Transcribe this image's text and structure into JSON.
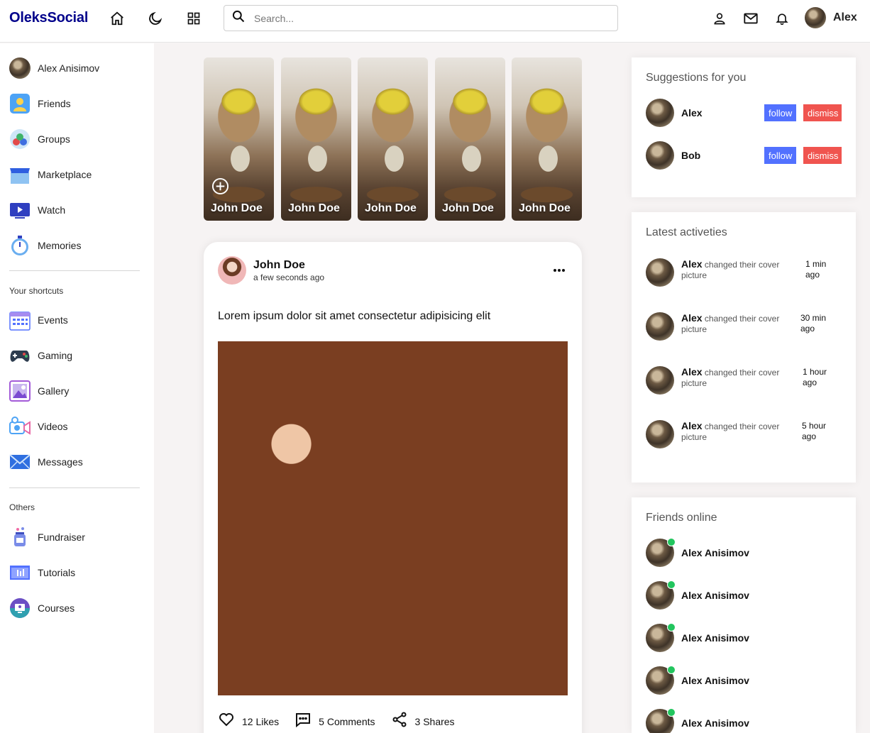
{
  "navbar": {
    "logo": "OleksSocial",
    "search_placeholder": "Search...",
    "user_name": "Alex"
  },
  "left": {
    "profile_name": "Alex Anisimov",
    "main_items": [
      "Friends",
      "Groups",
      "Marketplace",
      "Watch",
      "Memories"
    ],
    "shortcuts_title": "Your shortcuts",
    "shortcut_items": [
      "Events",
      "Gaming",
      "Gallery",
      "Videos",
      "Messages"
    ],
    "others_title": "Others",
    "other_items": [
      "Fundraiser",
      "Tutorials",
      "Courses"
    ]
  },
  "stories": [
    {
      "name": "John Doe"
    },
    {
      "name": "John Doe"
    },
    {
      "name": "John Doe"
    },
    {
      "name": "John Doe"
    },
    {
      "name": "John Doe"
    }
  ],
  "post": {
    "author": "John Doe",
    "time": "a few seconds ago",
    "text": "Lorem ipsum dolor sit amet consectetur adipisicing elit",
    "likes": "12 Likes",
    "comments": "5 Comments",
    "shares": "3 Shares"
  },
  "suggestions": {
    "title": "Suggestions for you",
    "follow_label": "follow",
    "dismiss_label": "dismiss",
    "people": [
      "Alex",
      "Bob"
    ]
  },
  "activities": {
    "title": "Latest activeties",
    "items": [
      {
        "user": "Alex",
        "text": "changed their cover picture",
        "time": "1 min ago"
      },
      {
        "user": "Alex",
        "text": "changed their cover picture",
        "time": "30 min ago"
      },
      {
        "user": "Alex",
        "text": "changed their cover picture",
        "time": "1 hour ago"
      },
      {
        "user": "Alex",
        "text": "changed their cover picture",
        "time": "5 hour ago"
      }
    ]
  },
  "friends_online": {
    "title": "Friends online",
    "friends": [
      "Alex Anisimov",
      "Alex Anisimov",
      "Alex Anisimov",
      "Alex Anisimov",
      "Alex Anisimov"
    ]
  },
  "colors": {
    "brand": "#00008b",
    "follow": "#5271ff",
    "dismiss": "#f0544f",
    "online": "#22c55e"
  }
}
